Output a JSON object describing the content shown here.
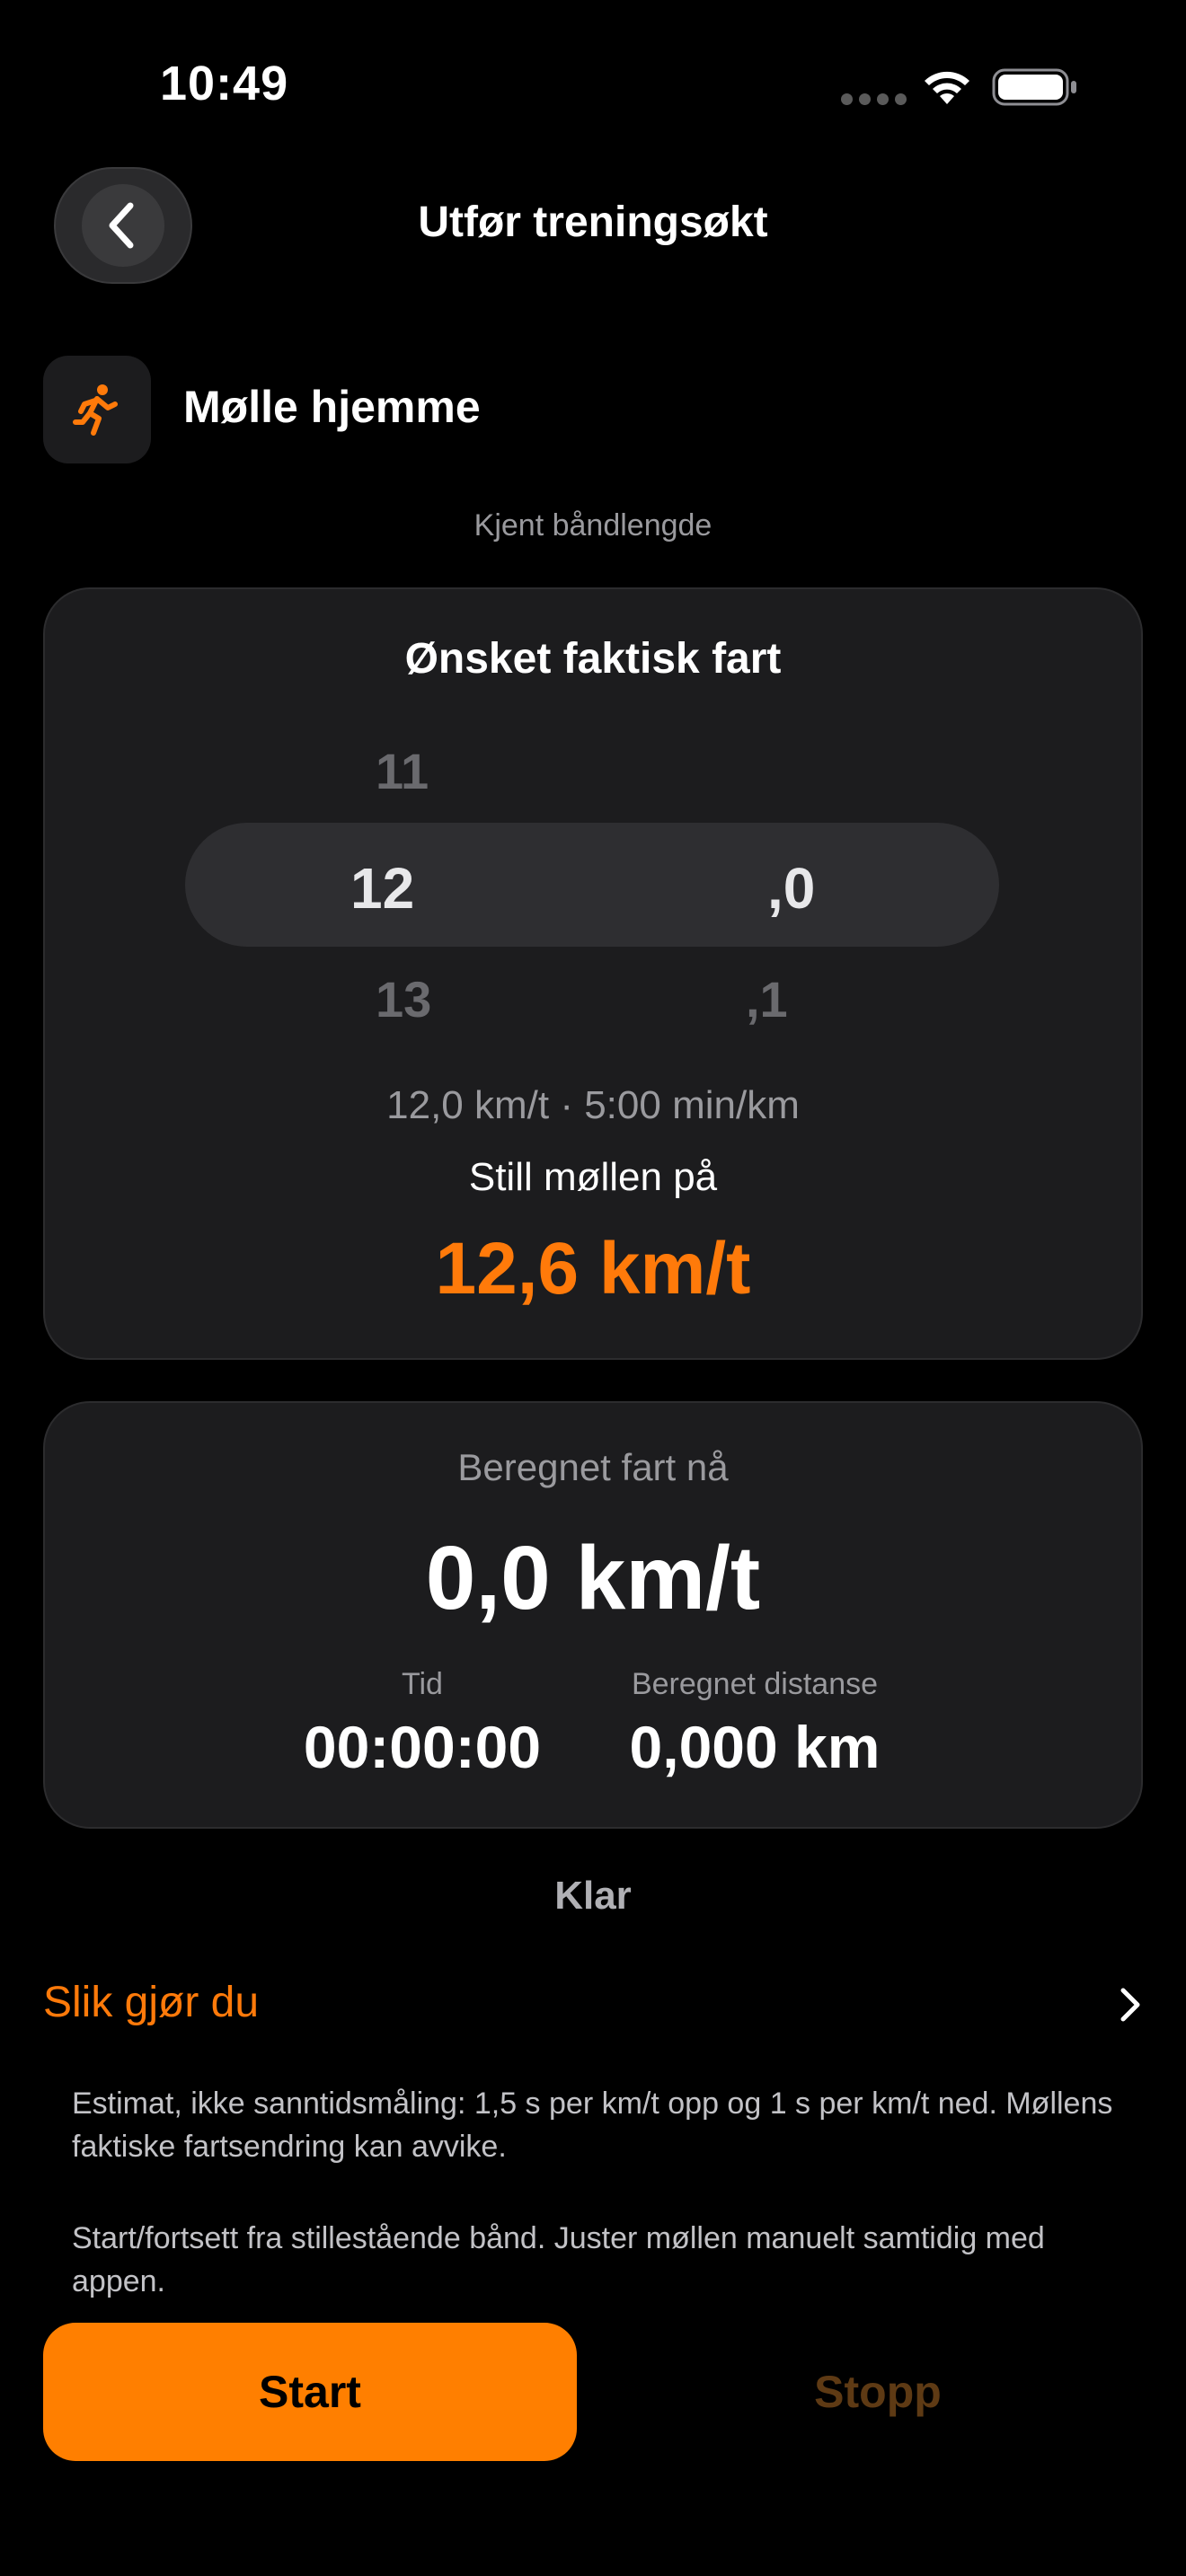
{
  "status_bar": {
    "time": "10:49",
    "icons": [
      "signal-dots-icon",
      "wifi-icon",
      "battery-icon"
    ]
  },
  "header": {
    "back_icon": "chevron-left-icon",
    "title": "Utfør treningsøkt"
  },
  "workout": {
    "icon": "running-figure-icon",
    "name": "Mølle hjemme",
    "subtitle": "Kjent båndlengde"
  },
  "target_speed_card": {
    "title": "Ønsket faktisk fart",
    "picker": {
      "whole": {
        "above": "11",
        "selected": "12",
        "below": "13"
      },
      "decimal": {
        "selected": ",0",
        "below": ",1"
      }
    },
    "pace_summary": "12,0 km/t · 5:00 min/km",
    "set_label": "Still møllen på",
    "set_value": "12,6 km/t"
  },
  "current_speed_card": {
    "label": "Beregnet fart nå",
    "speed": "0,0 km/t",
    "time_label": "Tid",
    "time_value": "00:00:00",
    "distance_label": "Beregnet distanse",
    "distance_value": "0,000 km"
  },
  "status": "Klar",
  "howto": {
    "label": "Slik gjør du",
    "icon": "chevron-right-icon"
  },
  "info": {
    "line1": "Estimat, ikke sanntidsmåling: 1,5 s per km/t opp og 1 s per km/t ned. Møllens faktiske fartsendring kan avvike.",
    "line2": "Start/fortsett fra stillestående bånd. Juster møllen manuelt samtidig med appen."
  },
  "actions": {
    "start": "Start",
    "stop": "Stopp"
  },
  "colors": {
    "accent": "#ff7f00",
    "background": "#000000",
    "card": "#1c1c1e",
    "disabled_accent": "#5e3a14"
  }
}
